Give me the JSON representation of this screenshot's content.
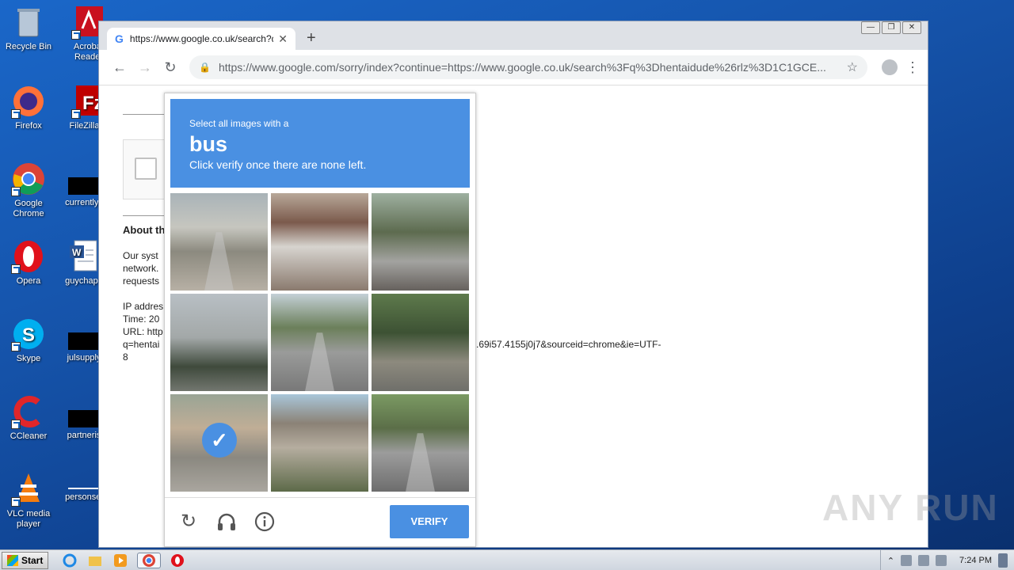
{
  "desktop": {
    "icons": [
      {
        "label": "Recycle Bin"
      },
      {
        "label": "Acrobat Reader"
      },
      {
        "label": "Firefox"
      },
      {
        "label": "FileZilla C"
      },
      {
        "label": "Google Chrome"
      },
      {
        "label": "currentlys"
      },
      {
        "label": "Opera"
      },
      {
        "label": "guychapb"
      },
      {
        "label": "Skype"
      },
      {
        "label": "julsupply"
      },
      {
        "label": "CCleaner"
      },
      {
        "label": "partneris"
      },
      {
        "label": "VLC media player"
      },
      {
        "label": "personsel"
      }
    ]
  },
  "browser": {
    "tab_title": "https://www.google.co.uk/search?q",
    "tab_close": "✕",
    "new_tab": "+",
    "url": "https://www.google.com/sorry/index?continue=https://www.google.co.uk/search%3Fq%3Dhentaidude%26rlz%3D1C1GCE..."
  },
  "page": {
    "about_heading": "About th",
    "body_lines": [
      "Our syst",
      "network.",
      "requests"
    ],
    "ip_lines": [
      "IP addres",
      "Time: 20",
      "URL: http",
      "q=hentai",
      "8"
    ],
    "url_tail": ".69i57.4155j0j7&sourceid=chrome&ie=UTF-"
  },
  "captcha": {
    "select_text": "Select all images with a",
    "target": "bus",
    "instruction": "Click verify once there are none left.",
    "tiles_selected": [
      false,
      false,
      false,
      false,
      false,
      false,
      true,
      false,
      false
    ],
    "verify_label": "VERIFY"
  },
  "watermark": "ANY RUN",
  "taskbar": {
    "start_label": "Start",
    "clock": "7:24 PM"
  }
}
